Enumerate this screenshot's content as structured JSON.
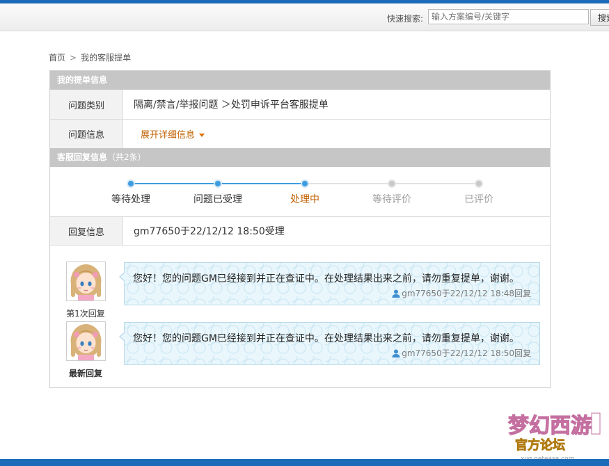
{
  "header": {
    "search_label": "快速搜索:",
    "search_placeholder": "输入方案编号/关键字",
    "search_button": "搜索"
  },
  "breadcrumb": {
    "home": "首页",
    "separator": ">",
    "current": "我的客服提单"
  },
  "ticket": {
    "section_title": "我的提单信息",
    "category_label": "问题类别",
    "category_value": "隔离/禁言/举报问题 ＞处罚申诉平台客服提单",
    "info_label": "问题信息",
    "expand_link": "展开详细信息"
  },
  "reply_section": {
    "title": "客服回复信息",
    "count": "（共2条）",
    "reply_label": "回复信息",
    "reply_value": "gm77650于22/12/12 18:50受理"
  },
  "progress": {
    "steps": [
      "等待处理",
      "问题已受理",
      "处理中",
      "等待评价",
      "已评价"
    ],
    "current_index": 2
  },
  "replies": [
    {
      "caption": "第1次回复",
      "message": "您好！您的问题GM已经接到并正在查证中。在处理结果出来之前，请勿重复提单，谢谢。",
      "meta": "gm77650于22/12/12 18:48回复"
    },
    {
      "caption": "最新回复",
      "message": "您好！您的问题GM已经接到并正在查证中。在处理结果出来之前，请勿重复提单，谢谢。",
      "meta": "gm77650于22/12/12 18:50回复"
    }
  ],
  "colors": {
    "accent_blue": "#1a6bb8",
    "progress_active": "#3d9ce0",
    "current_step": "#c06000",
    "section_header": "#c6c6c6"
  },
  "logo": {
    "name": "梦幻西游",
    "subtitle": "官方论坛",
    "url_text": "xyq.netease.com"
  }
}
